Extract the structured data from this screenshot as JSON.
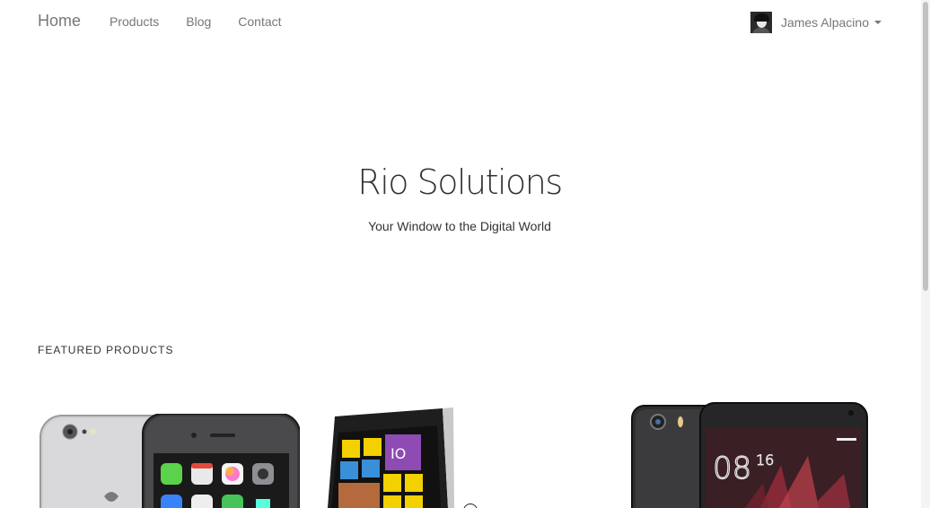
{
  "navbar": {
    "brand": "Home",
    "links": [
      {
        "label": "Products"
      },
      {
        "label": "Blog"
      },
      {
        "label": "Contact"
      }
    ],
    "user": {
      "name": "James Alpacino"
    }
  },
  "hero": {
    "title": "Rio Solutions",
    "subtitle": "Your Window to the Digital World"
  },
  "featured": {
    "heading": "FEATURED PRODUCTS",
    "products": [
      {
        "image": "iphone-6-image"
      },
      {
        "image": "lumia-phone-image"
      },
      {
        "image": "xiaomi-phone-image"
      }
    ]
  },
  "colors": {
    "nav_text": "#777777",
    "body_text": "#333333",
    "background": "#ffffff"
  }
}
